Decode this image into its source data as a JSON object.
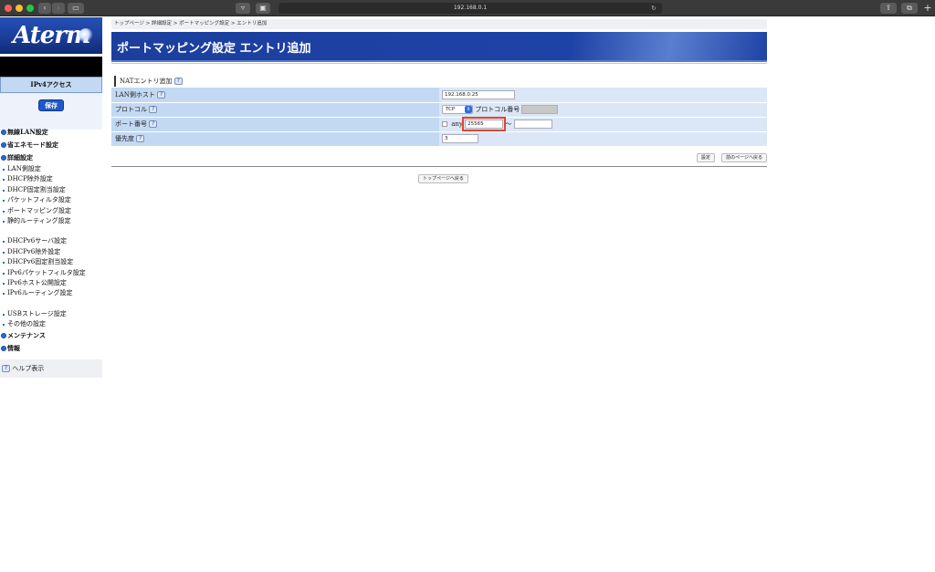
{
  "browser": {
    "url": "192.168.0.1"
  },
  "sidebar": {
    "logo": "Aterm",
    "mode": "IPv4アクセス",
    "save_label": "保存",
    "menu": [
      {
        "type": "header",
        "label": "無線LAN設定"
      },
      {
        "type": "header",
        "label": "省エネモード設定"
      },
      {
        "type": "header",
        "label": "詳細設定"
      },
      {
        "type": "sub",
        "label": "LAN側設定"
      },
      {
        "type": "sub",
        "label": "DHCP除外設定"
      },
      {
        "type": "sub",
        "label": "DHCP固定割当設定"
      },
      {
        "type": "sub",
        "label": "パケットフィルタ設定"
      },
      {
        "type": "sub",
        "label": "ポートマッピング設定"
      },
      {
        "type": "sub",
        "label": "静的ルーティング設定"
      },
      {
        "type": "gap"
      },
      {
        "type": "sub",
        "label": "DHCPv6サーバ設定"
      },
      {
        "type": "sub",
        "label": "DHCPv6除外設定"
      },
      {
        "type": "sub",
        "label": "DHCPv6固定割当設定"
      },
      {
        "type": "sub",
        "label": "IPv6パケットフィルタ設定"
      },
      {
        "type": "sub",
        "label": "IPv6ホスト公開設定"
      },
      {
        "type": "sub",
        "label": "IPv6ルーティング設定"
      },
      {
        "type": "gap"
      },
      {
        "type": "sub",
        "label": "USBストレージ設定"
      },
      {
        "type": "sub",
        "label": "その他の設定"
      },
      {
        "type": "header",
        "label": "メンテナンス"
      },
      {
        "type": "header",
        "label": "情報"
      }
    ],
    "help_label": "ヘルプ表示"
  },
  "main": {
    "breadcrumb": "トップページ > 詳細設定 > ポートマッピング設定 > エントリ追加",
    "title": "ポートマッピング設定 エントリ追加",
    "section_title": "NATエントリ追加",
    "rows": {
      "lan_host": {
        "label": "LAN側ホスト",
        "value": "192.168.0.25"
      },
      "protocol": {
        "label": "プロトコル",
        "selected": "TCP",
        "proto_num_label": "プロトコル番号"
      },
      "port": {
        "label": "ポート番号",
        "any_label": "any",
        "from": "25565",
        "to": ""
      },
      "priority": {
        "label": "優先度",
        "value": "3"
      }
    },
    "buttons": {
      "set": "設定",
      "back": "前のページへ戻る",
      "top": "トップページへ戻る"
    }
  }
}
